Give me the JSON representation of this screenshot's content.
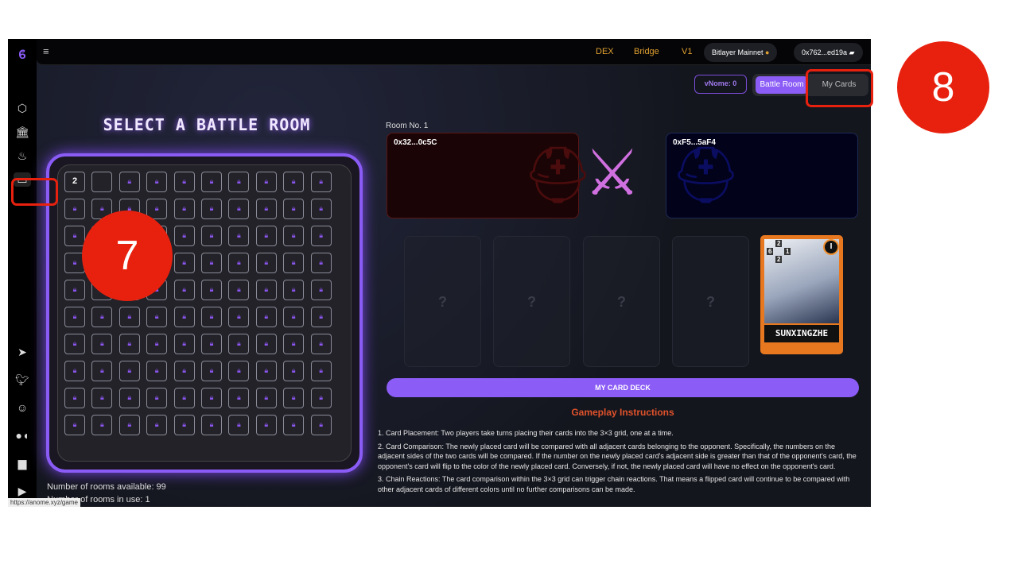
{
  "header": {
    "links": [
      "DEX",
      "Bridge",
      "V1"
    ],
    "network": "Bitlayer Mainnet",
    "wallet": "0x762...ed19a"
  },
  "toolbar": {
    "vnome": "vNome: 0",
    "tabs": [
      {
        "label": "Battle Room",
        "active": true
      },
      {
        "label": "My Cards",
        "active": false
      }
    ]
  },
  "left": {
    "title": "SELECT A BATTLE ROOM",
    "occupied_cell_label": "2",
    "rooms_available": "Number of rooms available: 99",
    "rooms_in_use": "Number of rooms in use: 1"
  },
  "room": {
    "label": "Room No. 1",
    "player1": "0x32...0c5C",
    "player2": "0xF5...5aF4",
    "slot_placeholder": "?",
    "card": {
      "name": "SUNXINGZHE",
      "level": "I",
      "stats": {
        "top": "2",
        "left": "6",
        "right": "1",
        "bottom": "2"
      }
    },
    "deck_button": "MY CARD DECK"
  },
  "instructions": {
    "title": "Gameplay Instructions",
    "items": [
      "1. Card Placement: Two players take turns placing their cards into the 3×3 grid, one at a time.",
      "2. Card Comparison: The newly placed card will be compared with all adjacent cards belonging to the opponent. Specifically, the numbers on the adjacent sides of the two cards will be compared. If the number on the newly placed card's adjacent side is greater than that of the opponent's card, the opponent's card will flip to the color of the newly placed card. Conversely, if not, the newly placed card will have no effect on the opponent's card.",
      "3. Chain Reactions: The card comparison within the 3×3 grid can trigger chain reactions. That means a flipped card will continue to be compared with other adjacent cards of different colors until no further comparisons can be made."
    ]
  },
  "status_url": "https://anome.xyz/game",
  "annotations": [
    "7",
    "8"
  ],
  "colors": {
    "accent": "#8b5cf6",
    "link": "#e0a030",
    "heading": "#e0522a",
    "annotation": "#e8210f"
  }
}
